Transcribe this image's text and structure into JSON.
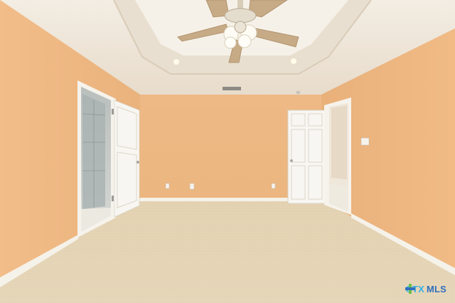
{
  "photo": {
    "subject": "empty-bedroom"
  },
  "colors": {
    "wall": "#efba84",
    "wall_shadow": "#e7ae75",
    "ceiling": "#f1e9dc",
    "carpet": "#e4d2b1",
    "door": "#f7f6f2",
    "trim": "#f5f2ea"
  },
  "watermark": {
    "brand": "CTX",
    "suffix": "MLS",
    "brand_color": "#35b0e6",
    "mls_color": "#2f6fbd"
  }
}
